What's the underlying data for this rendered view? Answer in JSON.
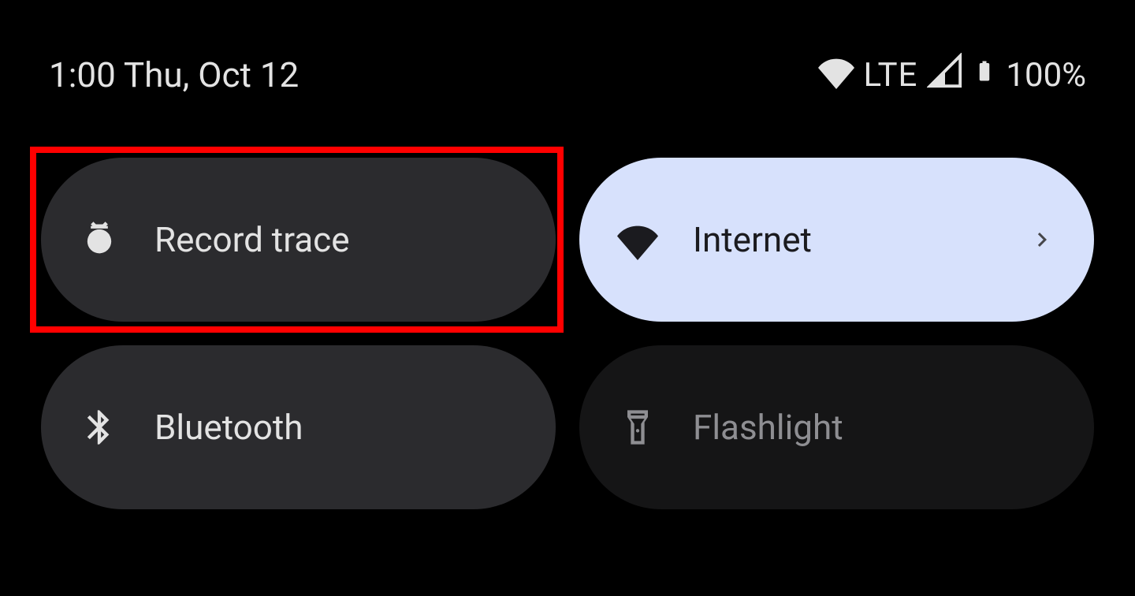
{
  "status_bar": {
    "datetime": "1:00 Thu, Oct 12",
    "network_label": "LTE",
    "battery_percent": "100%"
  },
  "tiles": [
    {
      "label": "Record trace",
      "icon": "bug-icon",
      "state": "inactive",
      "highlighted": true,
      "has_chevron": false
    },
    {
      "label": "Internet",
      "icon": "wifi-icon",
      "state": "active",
      "highlighted": false,
      "has_chevron": true
    },
    {
      "label": "Bluetooth",
      "icon": "bluetooth-icon",
      "state": "inactive",
      "highlighted": false,
      "has_chevron": false
    },
    {
      "label": "Flashlight",
      "icon": "flashlight-icon",
      "state": "dim",
      "highlighted": false,
      "has_chevron": false
    }
  ],
  "colors": {
    "bg": "#000000",
    "tile_inactive": "#2b2b2e",
    "tile_active": "#d7e1fc",
    "tile_dim": "#151516",
    "highlight": "#ff0000"
  }
}
